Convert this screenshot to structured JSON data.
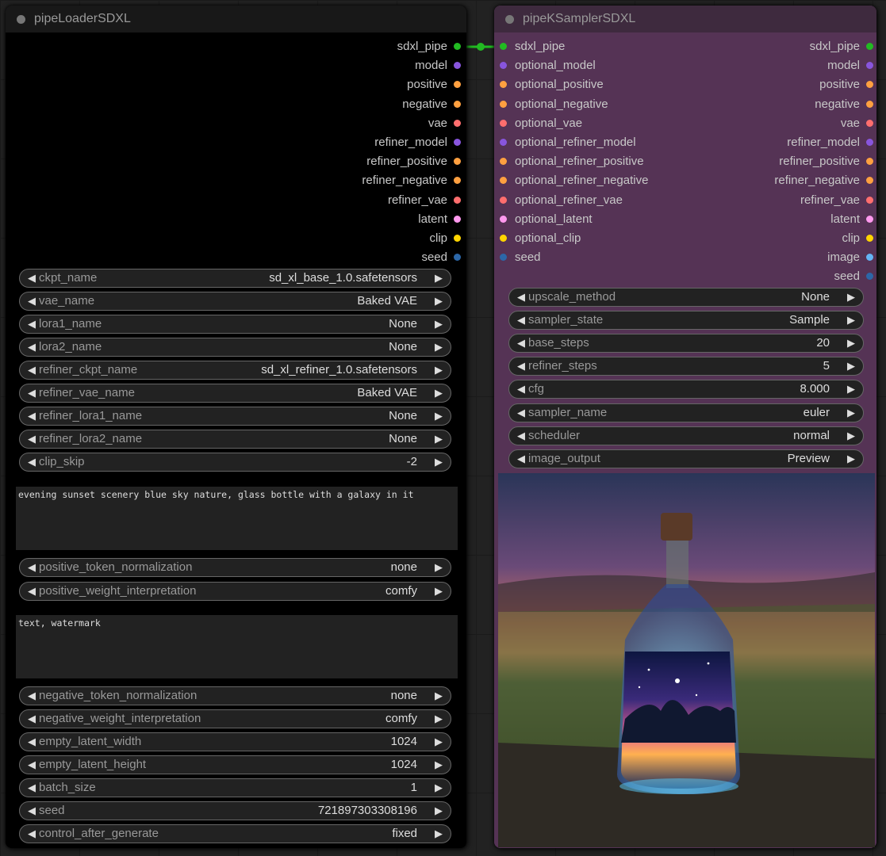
{
  "loader": {
    "title": "pipeLoaderSDXL",
    "outputs": [
      {
        "label": "sdxl_pipe",
        "color": "#22bb22"
      },
      {
        "label": "model",
        "color": "#8855dd"
      },
      {
        "label": "positive",
        "color": "#ffa040"
      },
      {
        "label": "negative",
        "color": "#ffa040"
      },
      {
        "label": "vae",
        "color": "#ff6e6e"
      },
      {
        "label": "refiner_model",
        "color": "#8855dd"
      },
      {
        "label": "refiner_positive",
        "color": "#ffa040"
      },
      {
        "label": "refiner_negative",
        "color": "#ffa040"
      },
      {
        "label": "refiner_vae",
        "color": "#ff6e6e"
      },
      {
        "label": "latent",
        "color": "#ff99ee"
      },
      {
        "label": "clip",
        "color": "#ffd500"
      },
      {
        "label": "seed",
        "color": "#2c67a8"
      }
    ],
    "widgets1": [
      {
        "label": "ckpt_name",
        "value": "sd_xl_base_1.0.safetensors"
      },
      {
        "label": "vae_name",
        "value": "Baked VAE"
      },
      {
        "label": "lora1_name",
        "value": "None"
      },
      {
        "label": "lora2_name",
        "value": "None"
      },
      {
        "label": "refiner_ckpt_name",
        "value": "sd_xl_refiner_1.0.safetensors"
      },
      {
        "label": "refiner_vae_name",
        "value": "Baked VAE"
      },
      {
        "label": "refiner_lora1_name",
        "value": "None"
      },
      {
        "label": "refiner_lora2_name",
        "value": "None"
      },
      {
        "label": "clip_skip",
        "value": "-2"
      }
    ],
    "positive_text": "evening sunset scenery blue sky nature, glass bottle with a galaxy in it",
    "widgets2": [
      {
        "label": "positive_token_normalization",
        "value": "none"
      },
      {
        "label": "positive_weight_interpretation",
        "value": "comfy"
      }
    ],
    "negative_text": "text, watermark",
    "widgets3": [
      {
        "label": "negative_token_normalization",
        "value": "none"
      },
      {
        "label": "negative_weight_interpretation",
        "value": "comfy"
      },
      {
        "label": "empty_latent_width",
        "value": "1024"
      },
      {
        "label": "empty_latent_height",
        "value": "1024"
      },
      {
        "label": "batch_size",
        "value": "1"
      },
      {
        "label": "seed",
        "value": "721897303308196"
      },
      {
        "label": "control_after_generate",
        "value": "fixed"
      }
    ]
  },
  "sampler": {
    "title": "pipeKSamplerSDXL",
    "inputs": [
      {
        "label": "sdxl_pipe",
        "color": "#22bb22"
      },
      {
        "label": "optional_model",
        "color": "#8855dd"
      },
      {
        "label": "optional_positive",
        "color": "#ffa040"
      },
      {
        "label": "optional_negative",
        "color": "#ffa040"
      },
      {
        "label": "optional_vae",
        "color": "#ff6e6e"
      },
      {
        "label": "optional_refiner_model",
        "color": "#8855dd"
      },
      {
        "label": "optional_refiner_positive",
        "color": "#ffa040"
      },
      {
        "label": "optional_refiner_negative",
        "color": "#ffa040"
      },
      {
        "label": "optional_refiner_vae",
        "color": "#ff6e6e"
      },
      {
        "label": "optional_latent",
        "color": "#ff99ee"
      },
      {
        "label": "optional_clip",
        "color": "#ffd500"
      },
      {
        "label": "seed",
        "color": "#2c67a8"
      }
    ],
    "outputs": [
      {
        "label": "sdxl_pipe",
        "color": "#22bb22"
      },
      {
        "label": "model",
        "color": "#8855dd"
      },
      {
        "label": "positive",
        "color": "#ffa040"
      },
      {
        "label": "negative",
        "color": "#ffa040"
      },
      {
        "label": "vae",
        "color": "#ff6e6e"
      },
      {
        "label": "refiner_model",
        "color": "#8855dd"
      },
      {
        "label": "refiner_positive",
        "color": "#ffa040"
      },
      {
        "label": "refiner_negative",
        "color": "#ffa040"
      },
      {
        "label": "refiner_vae",
        "color": "#ff6e6e"
      },
      {
        "label": "latent",
        "color": "#ff99ee"
      },
      {
        "label": "clip",
        "color": "#ffd500"
      },
      {
        "label": "image",
        "color": "#64b5f6"
      },
      {
        "label": "seed",
        "color": "#2c67a8"
      }
    ],
    "widgets": [
      {
        "label": "upscale_method",
        "value": "None"
      },
      {
        "label": "sampler_state",
        "value": "Sample"
      },
      {
        "label": "base_steps",
        "value": "20"
      },
      {
        "label": "refiner_steps",
        "value": "5"
      },
      {
        "label": "cfg",
        "value": "8.000"
      },
      {
        "label": "sampler_name",
        "value": "euler"
      },
      {
        "label": "scheduler",
        "value": "normal"
      },
      {
        "label": "image_output",
        "value": "Preview"
      }
    ]
  },
  "icons": {
    "left_arrow": "◀",
    "right_arrow": "▶"
  }
}
